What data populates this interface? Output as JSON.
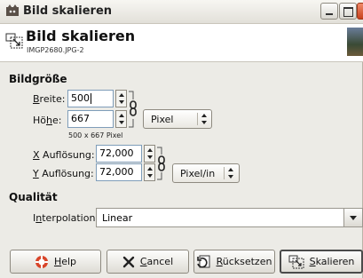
{
  "window": {
    "title": "Bild skalieren"
  },
  "header": {
    "title": "Bild skalieren",
    "subtitle": "IMGP2680.JPG-2"
  },
  "image_size": {
    "section_label": "Bildgröße",
    "width": {
      "label_key": "B",
      "label_rest": "reite:",
      "value": "500"
    },
    "height": {
      "label_pre": "Hö",
      "label_key": "h",
      "label_post": "e:",
      "value": "667"
    },
    "size_hint": "500 x 667 Pixel",
    "unit": "Pixel",
    "x_res": {
      "label_key": "X",
      "label_rest": " Auflösung:",
      "value": "72,000"
    },
    "y_res": {
      "label_key": "Y",
      "label_rest": " Auflösung:",
      "value": "72,000"
    },
    "res_unit": "Pixel/in"
  },
  "quality": {
    "section_label": "Qualität",
    "interp_label_pre": "I",
    "interp_label_key": "n",
    "interp_label_post": "terpolation:",
    "interp_value": "Linear"
  },
  "buttons": {
    "help": {
      "key": "H",
      "rest": "elp"
    },
    "cancel": {
      "key": "C",
      "rest": "ancel"
    },
    "reset": {
      "key": "R",
      "rest": "ücksetzen"
    },
    "scale": {
      "key": "S",
      "rest": "kalieren"
    }
  },
  "colors": {
    "titlebar": "#ecebe6",
    "close": "#d05a36",
    "input_border": "#7f9db9"
  }
}
